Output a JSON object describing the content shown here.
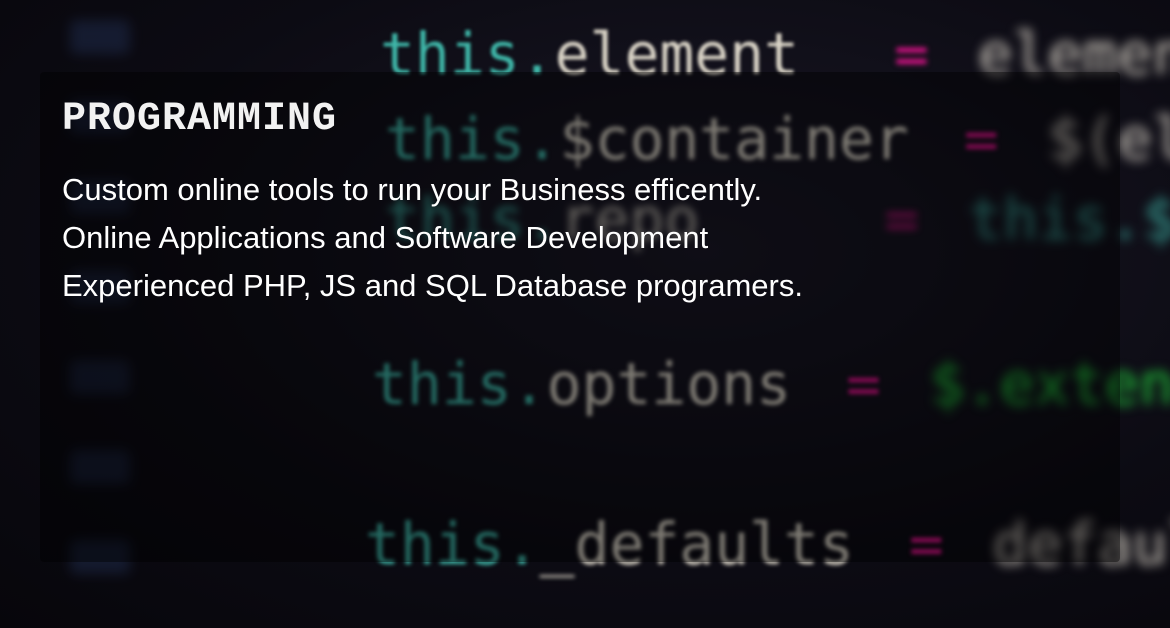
{
  "hero": {
    "title": "PROGRAMMING",
    "lines": [
      "Custom online tools to run your Business efficently.",
      "Online Applications and Software Development",
      "Experienced PHP, JS and SQL Database programers."
    ]
  },
  "background_code": {
    "lines": [
      {
        "obj": "this.",
        "prop": "element",
        "op": "=",
        "val": "element;"
      },
      {
        "obj": "this.",
        "prop": "$container",
        "op": "=",
        "val": "$(element);"
      },
      {
        "obj": "this.",
        "prop": "repo",
        "op": "=",
        "val": "this.$container.find"
      },
      {
        "obj": "this.",
        "prop": "options",
        "op": "=",
        "val": "$.extend({}, this.options"
      },
      {
        "obj": "this.",
        "prop": "_defaults",
        "op": "=",
        "val": "defaults;"
      }
    ]
  },
  "colors": {
    "obj": "#3fb6a8",
    "prop": "#d9d3c6",
    "op": "#e0138c",
    "val": "#c8c2b8",
    "extend": "#21c23a",
    "panel": "rgba(0,0,0,0.42)"
  }
}
